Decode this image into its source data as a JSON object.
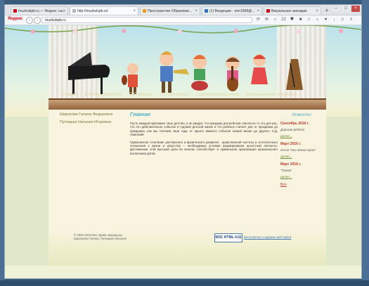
{
  "browser": {
    "tabs": [
      {
        "label": "muzkulspb.ru — Яндекс: на...",
        "color": "#d0021b"
      },
      {
        "label": "http://muzkulspb.ru/",
        "color": "#b0b8c0"
      },
      {
        "label": "Пространство Образован...",
        "color": "#f39c12"
      },
      {
        "label": "(1) Входящие - smr1968@...",
        "color": "#2e6fbf"
      },
      {
        "label": "Визуальные закладки",
        "color": "#d0021b"
      }
    ],
    "new_tab": "+",
    "brand": "Яндекс",
    "url": "muzkulspb.ru",
    "toolbar_counter": "22"
  },
  "site": {
    "menu": [
      "Главная",
      "Для Вас, родители!",
      "Публикации",
      "Это интересно",
      "Сценарии праздников",
      "Дистанционное обучение"
    ],
    "left_links": [
      "Широкова Галина Федоровна",
      "Пучицкая Наталия Игоревна"
    ],
    "main_title": "Главная",
    "paragraphs": [
      "Пусть каждый припомнит свое детство, и он увидит, что праздник для ребенка совсем не то что для нас, что это действительно событие в годовой детской жизни и что ребенок считает дни от праздника до праздника, как мы считаем свои годы от одного важного события нашей жизни до другого. К.Д. Ушинский",
      "Гармоничное сочетание умственного и физического развития , нравственной чистоты и эстетического отношения к жизни и искусству – необходимые условия формирования целостной личности. Достижению этой высокой цели во многом способствует и правильная организация музыкального воспитания детей."
    ],
    "news_title": "Новости",
    "news": [
      {
        "date": "Сентябрь 2016 г.",
        "text": "Дорогие ребята!",
        "more": "далее..."
      },
      {
        "date": "Март 2016 г.",
        "text": "песня \"Мы печем герои\"",
        "more": "далее..."
      },
      {
        "date": "Март 2016 г.",
        "text": "\"Терем\"",
        "more": "далее..."
      }
    ],
    "news_all": "Все",
    "copyright": [
      "© 2009-2016 Все права защищены",
      "Широкова Галина, Пучицкая Наталия"
    ],
    "w3c_badge": "W3C HTML 4.01",
    "w3c_link": "Бесплатное создание веб-сайта"
  }
}
